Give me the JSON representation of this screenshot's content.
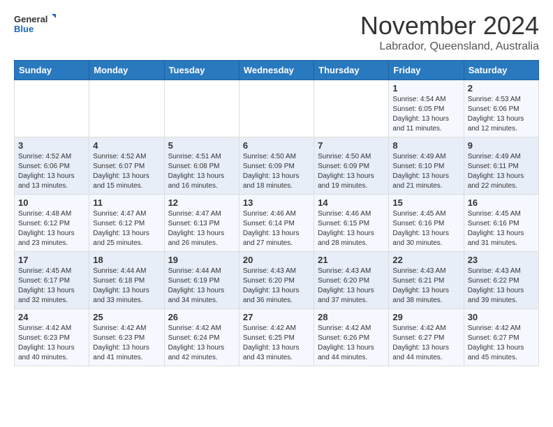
{
  "header": {
    "logo_general": "General",
    "logo_blue": "Blue",
    "month_title": "November 2024",
    "location": "Labrador, Queensland, Australia"
  },
  "days_of_week": [
    "Sunday",
    "Monday",
    "Tuesday",
    "Wednesday",
    "Thursday",
    "Friday",
    "Saturday"
  ],
  "weeks": [
    [
      {
        "day": "",
        "info": ""
      },
      {
        "day": "",
        "info": ""
      },
      {
        "day": "",
        "info": ""
      },
      {
        "day": "",
        "info": ""
      },
      {
        "day": "",
        "info": ""
      },
      {
        "day": "1",
        "info": "Sunrise: 4:54 AM\nSunset: 6:05 PM\nDaylight: 13 hours and 11 minutes."
      },
      {
        "day": "2",
        "info": "Sunrise: 4:53 AM\nSunset: 6:06 PM\nDaylight: 13 hours and 12 minutes."
      }
    ],
    [
      {
        "day": "3",
        "info": "Sunrise: 4:52 AM\nSunset: 6:06 PM\nDaylight: 13 hours and 13 minutes."
      },
      {
        "day": "4",
        "info": "Sunrise: 4:52 AM\nSunset: 6:07 PM\nDaylight: 13 hours and 15 minutes."
      },
      {
        "day": "5",
        "info": "Sunrise: 4:51 AM\nSunset: 6:08 PM\nDaylight: 13 hours and 16 minutes."
      },
      {
        "day": "6",
        "info": "Sunrise: 4:50 AM\nSunset: 6:09 PM\nDaylight: 13 hours and 18 minutes."
      },
      {
        "day": "7",
        "info": "Sunrise: 4:50 AM\nSunset: 6:09 PM\nDaylight: 13 hours and 19 minutes."
      },
      {
        "day": "8",
        "info": "Sunrise: 4:49 AM\nSunset: 6:10 PM\nDaylight: 13 hours and 21 minutes."
      },
      {
        "day": "9",
        "info": "Sunrise: 4:49 AM\nSunset: 6:11 PM\nDaylight: 13 hours and 22 minutes."
      }
    ],
    [
      {
        "day": "10",
        "info": "Sunrise: 4:48 AM\nSunset: 6:12 PM\nDaylight: 13 hours and 23 minutes."
      },
      {
        "day": "11",
        "info": "Sunrise: 4:47 AM\nSunset: 6:12 PM\nDaylight: 13 hours and 25 minutes."
      },
      {
        "day": "12",
        "info": "Sunrise: 4:47 AM\nSunset: 6:13 PM\nDaylight: 13 hours and 26 minutes."
      },
      {
        "day": "13",
        "info": "Sunrise: 4:46 AM\nSunset: 6:14 PM\nDaylight: 13 hours and 27 minutes."
      },
      {
        "day": "14",
        "info": "Sunrise: 4:46 AM\nSunset: 6:15 PM\nDaylight: 13 hours and 28 minutes."
      },
      {
        "day": "15",
        "info": "Sunrise: 4:45 AM\nSunset: 6:16 PM\nDaylight: 13 hours and 30 minutes."
      },
      {
        "day": "16",
        "info": "Sunrise: 4:45 AM\nSunset: 6:16 PM\nDaylight: 13 hours and 31 minutes."
      }
    ],
    [
      {
        "day": "17",
        "info": "Sunrise: 4:45 AM\nSunset: 6:17 PM\nDaylight: 13 hours and 32 minutes."
      },
      {
        "day": "18",
        "info": "Sunrise: 4:44 AM\nSunset: 6:18 PM\nDaylight: 13 hours and 33 minutes."
      },
      {
        "day": "19",
        "info": "Sunrise: 4:44 AM\nSunset: 6:19 PM\nDaylight: 13 hours and 34 minutes."
      },
      {
        "day": "20",
        "info": "Sunrise: 4:43 AM\nSunset: 6:20 PM\nDaylight: 13 hours and 36 minutes."
      },
      {
        "day": "21",
        "info": "Sunrise: 4:43 AM\nSunset: 6:20 PM\nDaylight: 13 hours and 37 minutes."
      },
      {
        "day": "22",
        "info": "Sunrise: 4:43 AM\nSunset: 6:21 PM\nDaylight: 13 hours and 38 minutes."
      },
      {
        "day": "23",
        "info": "Sunrise: 4:43 AM\nSunset: 6:22 PM\nDaylight: 13 hours and 39 minutes."
      }
    ],
    [
      {
        "day": "24",
        "info": "Sunrise: 4:42 AM\nSunset: 6:23 PM\nDaylight: 13 hours and 40 minutes."
      },
      {
        "day": "25",
        "info": "Sunrise: 4:42 AM\nSunset: 6:23 PM\nDaylight: 13 hours and 41 minutes."
      },
      {
        "day": "26",
        "info": "Sunrise: 4:42 AM\nSunset: 6:24 PM\nDaylight: 13 hours and 42 minutes."
      },
      {
        "day": "27",
        "info": "Sunrise: 4:42 AM\nSunset: 6:25 PM\nDaylight: 13 hours and 43 minutes."
      },
      {
        "day": "28",
        "info": "Sunrise: 4:42 AM\nSunset: 6:26 PM\nDaylight: 13 hours and 44 minutes."
      },
      {
        "day": "29",
        "info": "Sunrise: 4:42 AM\nSunset: 6:27 PM\nDaylight: 13 hours and 44 minutes."
      },
      {
        "day": "30",
        "info": "Sunrise: 4:42 AM\nSunset: 6:27 PM\nDaylight: 13 hours and 45 minutes."
      }
    ]
  ]
}
